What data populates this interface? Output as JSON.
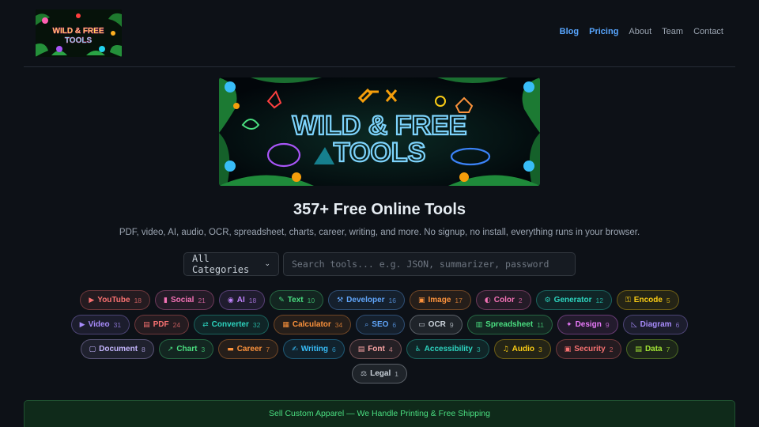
{
  "header": {
    "logo_text_line1": "WILD & FREE",
    "logo_text_line2": "TOOLS",
    "nav": [
      {
        "label": "Blog",
        "highlight": true
      },
      {
        "label": "Pricing",
        "highlight": true
      },
      {
        "label": "About",
        "highlight": false
      },
      {
        "label": "Team",
        "highlight": false
      },
      {
        "label": "Contact",
        "highlight": false
      }
    ]
  },
  "banner": {
    "line1": "WILD & FREE",
    "line2": "TOOLS"
  },
  "hero": {
    "title": "357+ Free Online Tools",
    "subtitle": "PDF, video, AI, audio, OCR, spreadsheet, charts, career, writing, and more. No signup, no install, everything runs in your browser."
  },
  "filters": {
    "category_selected": "All Categories",
    "search_placeholder": "Search tools... e.g. JSON, summarizer, password"
  },
  "categories": [
    {
      "icon": "▶",
      "label": "YouTube",
      "count": "18",
      "color": "#f87171"
    },
    {
      "icon": "▮",
      "label": "Social",
      "count": "21",
      "color": "#f472b6"
    },
    {
      "icon": "◉",
      "label": "AI",
      "count": "18",
      "color": "#c084fc"
    },
    {
      "icon": "✎",
      "label": "Text",
      "count": "10",
      "color": "#4ade80"
    },
    {
      "icon": "⚒",
      "label": "Developer",
      "count": "16",
      "color": "#60a5fa"
    },
    {
      "icon": "▣",
      "label": "Image",
      "count": "17",
      "color": "#fb923c"
    },
    {
      "icon": "◐",
      "label": "Color",
      "count": "2",
      "color": "#f472b6"
    },
    {
      "icon": "⚙",
      "label": "Generator",
      "count": "12",
      "color": "#2dd4bf"
    },
    {
      "icon": "⚿",
      "label": "Encode",
      "count": "5",
      "color": "#facc15"
    },
    {
      "icon": "▶",
      "label": "Video",
      "count": "31",
      "color": "#a78bfa"
    },
    {
      "icon": "▤",
      "label": "PDF",
      "count": "24",
      "color": "#f87171"
    },
    {
      "icon": "⇄",
      "label": "Converter",
      "count": "32",
      "color": "#2dd4bf"
    },
    {
      "icon": "▦",
      "label": "Calculator",
      "count": "34",
      "color": "#fb923c"
    },
    {
      "icon": "⌕",
      "label": "SEO",
      "count": "6",
      "color": "#60a5fa"
    },
    {
      "icon": "▭",
      "label": "OCR",
      "count": "9",
      "color": "#c9d1d9"
    },
    {
      "icon": "▥",
      "label": "Spreadsheet",
      "count": "11",
      "color": "#4ade80"
    },
    {
      "icon": "✦",
      "label": "Design",
      "count": "9",
      "color": "#e879f9"
    },
    {
      "icon": "◺",
      "label": "Diagram",
      "count": "6",
      "color": "#a78bfa"
    },
    {
      "icon": "▢",
      "label": "Document",
      "count": "8",
      "color": "#c4b5fd"
    },
    {
      "icon": "↗",
      "label": "Chart",
      "count": "3",
      "color": "#4ade80"
    },
    {
      "icon": "▬",
      "label": "Career",
      "count": "7",
      "color": "#fb923c"
    },
    {
      "icon": "✍",
      "label": "Writing",
      "count": "6",
      "color": "#38bdf8"
    },
    {
      "icon": "▤",
      "label": "Font",
      "count": "4",
      "color": "#fca5a5"
    },
    {
      "icon": "♿",
      "label": "Accessibility",
      "count": "3",
      "color": "#2dd4bf"
    },
    {
      "icon": "♫",
      "label": "Audio",
      "count": "3",
      "color": "#facc15"
    },
    {
      "icon": "▣",
      "label": "Security",
      "count": "2",
      "color": "#f87171"
    },
    {
      "icon": "▤",
      "label": "Data",
      "count": "7",
      "color": "#a3e635"
    },
    {
      "icon": "⚖",
      "label": "Legal",
      "count": "1",
      "color": "#c9d1d9"
    }
  ],
  "promo": {
    "text": "Sell Custom Apparel — We Handle Printing & Free Shipping"
  },
  "colors": {
    "background": "#0d1117",
    "accent": "#58a6ff",
    "promo": "#4ade80"
  }
}
